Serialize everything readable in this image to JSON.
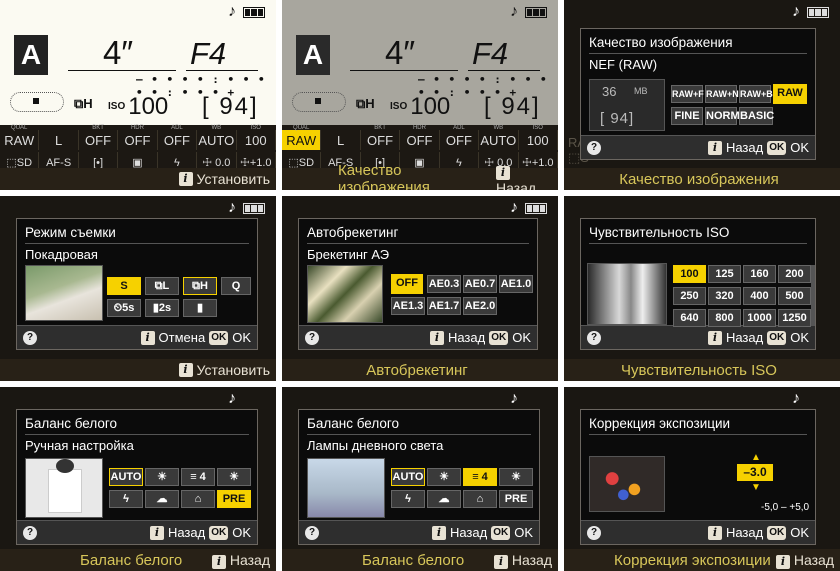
{
  "colors": {
    "accent": "#f6d100",
    "info_bg": "#fbfaf2",
    "dialog_bg": "#0b0b0b"
  },
  "icons": {
    "music": "music-note-icon",
    "battery": "battery-icon",
    "help": "help-icon",
    "info": "info-icon",
    "ok": "ok-icon"
  },
  "info": {
    "mode": "A",
    "shutter": "4″",
    "aperture": "F4",
    "iso_label": "ISO",
    "iso": "100",
    "remaining": "[ 94]",
    "release": "⧉H",
    "meter": "– • • • • : • • • • • : • • • +",
    "row1": [
      {
        "lbl": "QUAL",
        "val": "RAW"
      },
      {
        "lbl": "",
        "val": "L"
      },
      {
        "lbl": "BKT",
        "val": "OFF"
      },
      {
        "lbl": "HDR",
        "val": "OFF"
      },
      {
        "lbl": "ADL",
        "val": "OFF"
      },
      {
        "lbl": "WB",
        "val": "AUTO"
      },
      {
        "lbl": "ISO",
        "val": "100"
      }
    ],
    "row2": [
      {
        "val": "⬚SD"
      },
      {
        "val": "AF-S"
      },
      {
        "val": "[•]"
      },
      {
        "val": "▣"
      },
      {
        "val": "ϟ SLOW"
      },
      {
        "val": "☩ 0.0"
      },
      {
        "val": "☩+1.0"
      }
    ]
  },
  "panels": [
    {
      "bottom": {
        "i": "i",
        "text": "Установить"
      }
    },
    {
      "bottom": {
        "text": "Качество изображения",
        "i": "i",
        "back": "Назад"
      }
    },
    {
      "title": "Качество изображения",
      "sub": "NEF (RAW)",
      "size": "36",
      "unit": "MB",
      "count": "[ 94]",
      "opts": [
        "RAW+F",
        "RAW+N",
        "RAW+B",
        "RAW",
        "FINE",
        "NORM",
        "BASIC"
      ],
      "foot_i": "i",
      "back": "Назад",
      "ok": "OK",
      "okt": "OK",
      "bottom": "Качество изображения"
    },
    {
      "title": "Режим съемки",
      "sub": "Покадровая",
      "opts": [
        "S",
        "⧉L",
        "⧉H",
        "Q",
        "⏲5s",
        "▮2s",
        "▮"
      ],
      "foot_i": "i",
      "back": "Отмена",
      "ok": "OK",
      "okt": "OK",
      "bottom": "Установить",
      "bottom_i": "i"
    },
    {
      "title": "Автобрекетинг",
      "sub": "Брекетинг АЭ",
      "opts": [
        "OFF",
        "AE0.3",
        "AE0.7",
        "AE1.0",
        "AE1.3",
        "AE1.7",
        "AE2.0"
      ],
      "foot_i": "i",
      "back": "Назад",
      "ok": "OK",
      "okt": "OK",
      "bottom": "Автобрекетинг"
    },
    {
      "title": "Чувствительность ISO",
      "opts": [
        "100",
        "125",
        "160",
        "200",
        "250",
        "320",
        "400",
        "500",
        "640",
        "800",
        "1000",
        "1250"
      ],
      "foot_i": "i",
      "back": "Назад",
      "ok": "OK",
      "okt": "OK",
      "bottom": "Чувствительность ISO"
    },
    {
      "title": "Баланс белого",
      "sub": "Ручная настройка",
      "opts": [
        "AUTO",
        "☀",
        "≡ 4",
        "☀",
        "ϟ",
        "☁",
        "⌂",
        "PRE"
      ],
      "foot_i": "i",
      "back": "Назад",
      "ok": "OK",
      "okt": "OK",
      "bottom": "Баланс белого"
    },
    {
      "title": "Баланс белого",
      "sub": "Лампы дневного света",
      "opts": [
        "AUTO",
        "☀",
        "≡ 4",
        "☀",
        "ϟ",
        "☁",
        "⌂",
        "PRE"
      ],
      "foot_i": "i",
      "back": "Назад",
      "ok": "OK",
      "okt": "OK",
      "bottom": "Баланс белого"
    },
    {
      "title": "Коррекция экспозиции",
      "value": "–3.0",
      "range": "-5,0 – +5,0",
      "foot_i": "i",
      "back": "Назад",
      "ok": "OK",
      "okt": "OK",
      "bottom": "Коррекция экспозиции"
    }
  ]
}
